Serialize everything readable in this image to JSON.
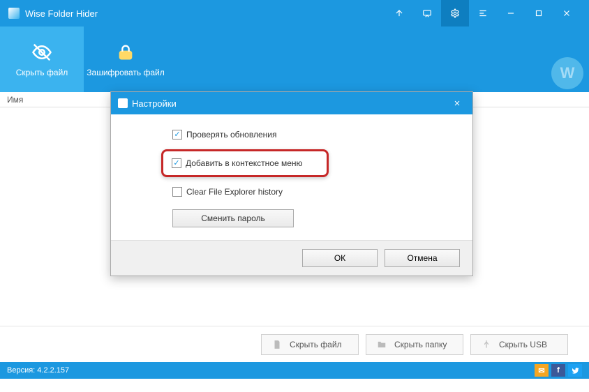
{
  "titlebar": {
    "title": "Wise Folder Hider"
  },
  "toolbar": {
    "hide_file": "Скрыть файл",
    "encrypt_file": "Зашифровать файл"
  },
  "list": {
    "col_name": "Имя"
  },
  "dialog": {
    "title": "Настройки",
    "chk_updates": "Проверять обновления",
    "chk_context": "Добавить в контекстное меню",
    "chk_clear_history": "Clear File Explorer history",
    "change_password": "Сменить пароль",
    "ok": "ОК",
    "cancel": "Отмена"
  },
  "bottom": {
    "hide_file": "Скрыть файл",
    "hide_folder": "Скрыть папку",
    "hide_usb": "Скрыть USB"
  },
  "status": {
    "version": "Версия: 4.2.2.157"
  },
  "watermark": "W"
}
